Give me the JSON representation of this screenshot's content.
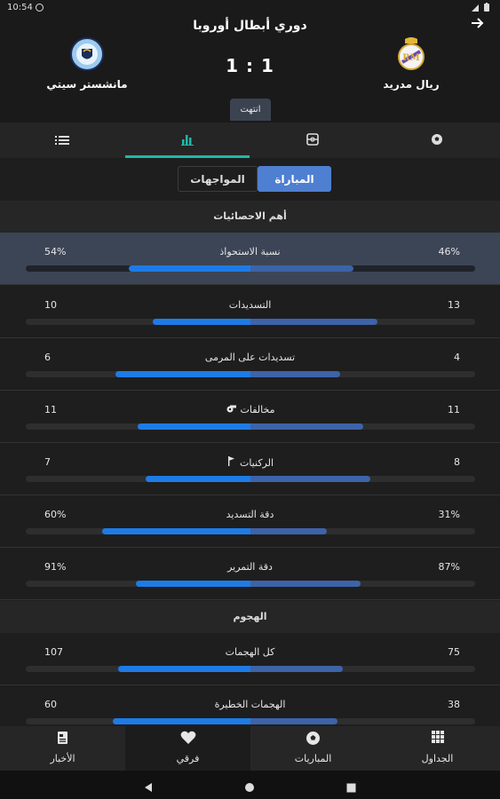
{
  "statusbar": {
    "time": "10:54"
  },
  "header": {
    "league": "دوري أبطال أوروبا",
    "home_team": "ريال مدريد",
    "away_team": "مانشستر سيتي",
    "score": "1 : 1",
    "status": "انتهت"
  },
  "tabs": [
    {
      "icon": "soccer-ball-icon"
    },
    {
      "icon": "lineup-icon"
    },
    {
      "icon": "stats-bars-icon",
      "active": true
    },
    {
      "icon": "list-icon"
    }
  ],
  "segments": {
    "match": "المباراة",
    "h2h": "المواجهات"
  },
  "sections": {
    "top": "أهم الاحصائيات",
    "attack": "الهجوم"
  },
  "stats": [
    {
      "label": "نسبة الاستحواذ",
      "home": "46%",
      "away": "54%",
      "home_value": 46,
      "away_value": 54
    },
    {
      "label": "التسديدات",
      "home": "13",
      "away": "10",
      "home_value": 13,
      "away_value": 10
    },
    {
      "label": "تسديدات على المرمى",
      "home": "4",
      "away": "6",
      "home_value": 4,
      "away_value": 6
    },
    {
      "label": "مخالفات",
      "home": "11",
      "away": "11",
      "home_value": 11,
      "away_value": 11,
      "icon": "whistle-icon"
    },
    {
      "label": "الركنيات",
      "home": "8",
      "away": "7",
      "home_value": 8,
      "away_value": 7,
      "icon": "corner-flag-icon"
    },
    {
      "label": "دقة التسديد",
      "home": "31%",
      "away": "60%",
      "home_value": 31,
      "away_value": 60
    },
    {
      "label": "دقة التمرير",
      "home": "87%",
      "away": "91%",
      "home_value": 87,
      "away_value": 91
    },
    {
      "label": "كل الهجمات",
      "home": "75",
      "away": "107",
      "home_value": 75,
      "away_value": 107
    },
    {
      "label": "الهجمات الخطيرة",
      "home": "38",
      "away": "60",
      "home_value": 38,
      "away_value": 60
    }
  ],
  "bottomnav": {
    "news": "الأخبار",
    "myteam": "فرقي",
    "matches": "المباريات",
    "tables": "الجداول"
  },
  "colors": {
    "accent": "#20b8a8",
    "away_bar": "#1e7be6",
    "home_bar": "#3d63a8",
    "highlight_row": "#3c4556"
  }
}
